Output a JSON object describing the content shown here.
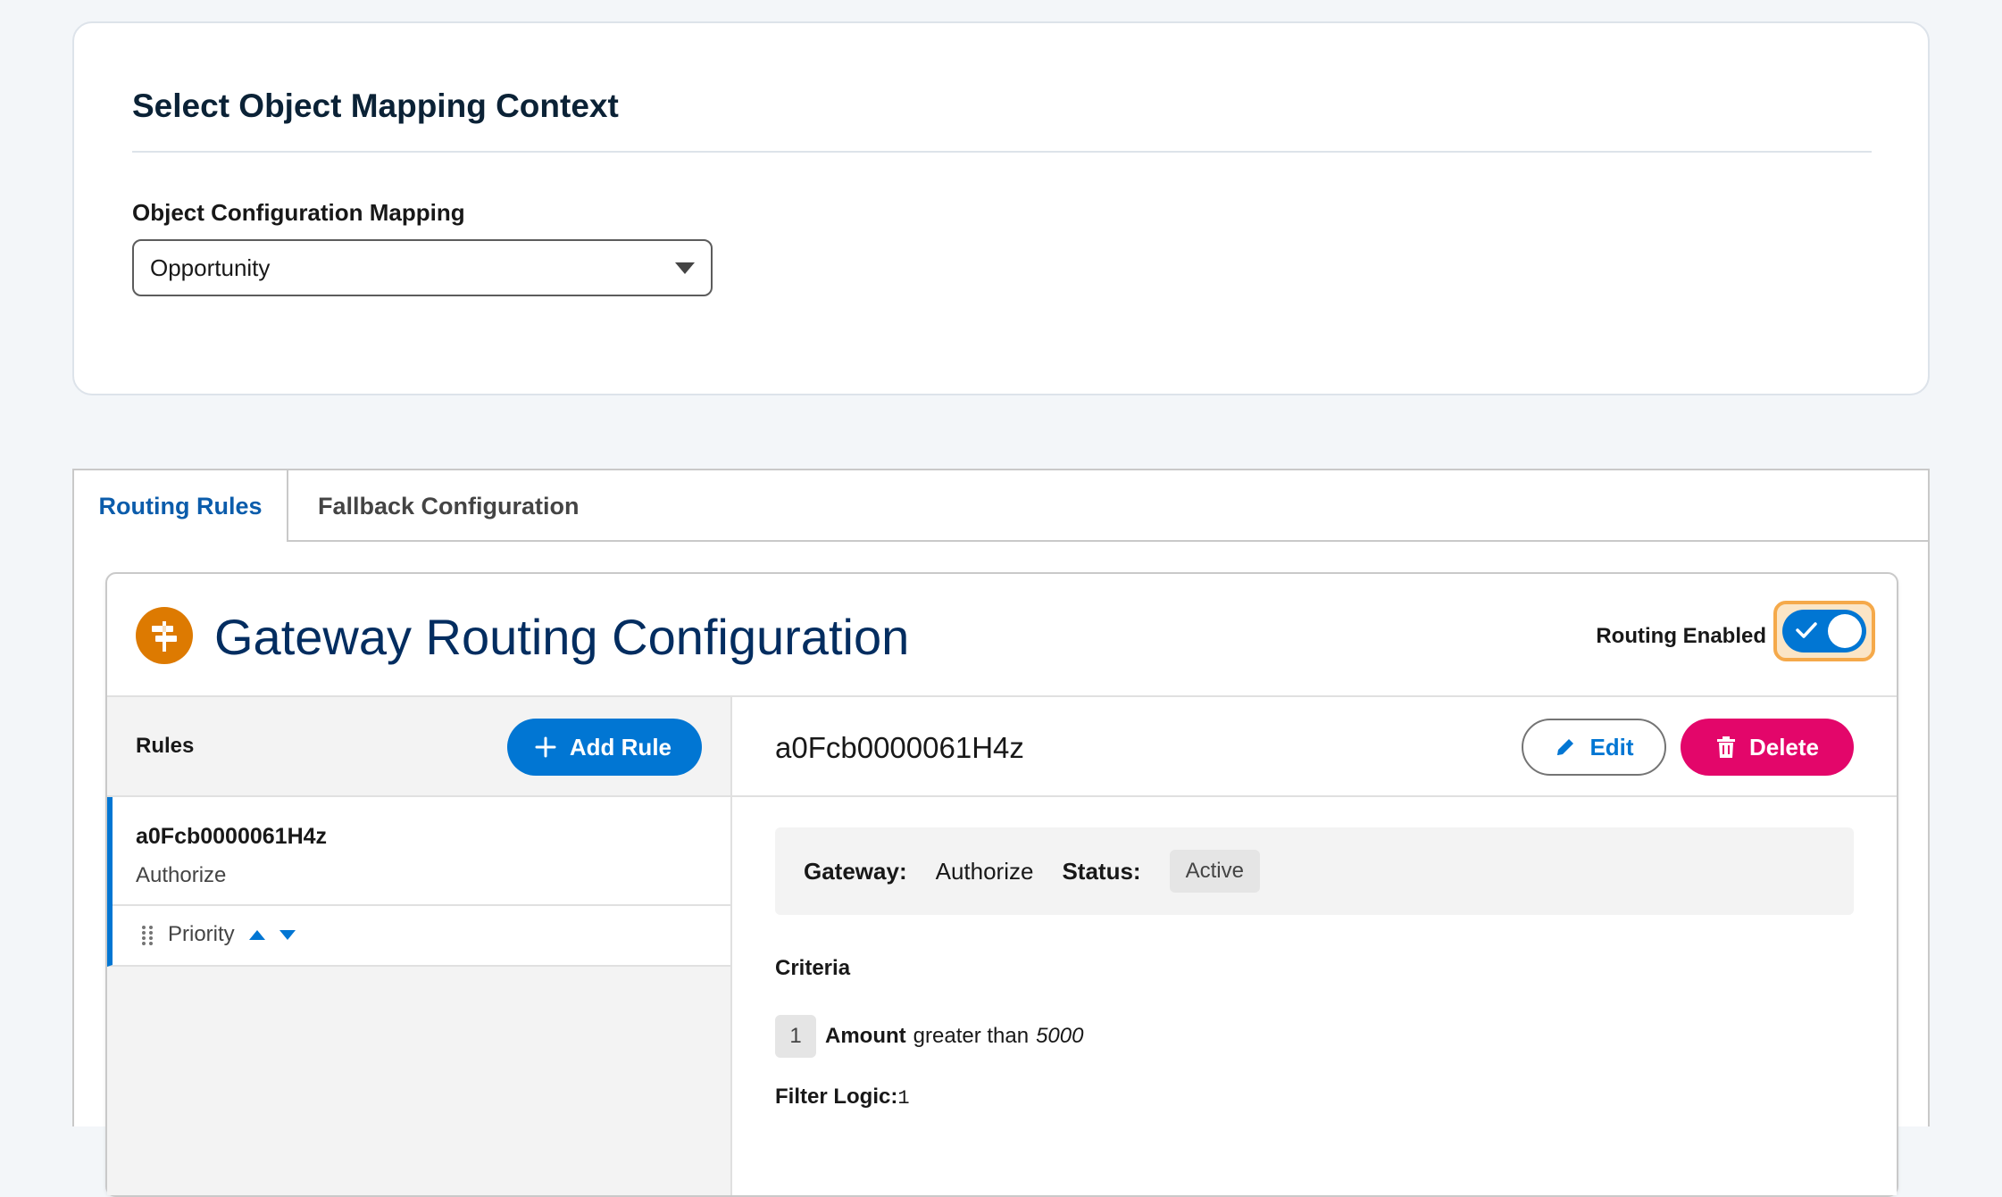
{
  "context_card": {
    "title": "Select Object Mapping Context",
    "field_label": "Object Configuration Mapping",
    "selected_value": "Opportunity"
  },
  "tabs": [
    {
      "label": "Routing Rules",
      "active": true
    },
    {
      "label": "Fallback Configuration",
      "active": false
    }
  ],
  "config": {
    "title": "Gateway Routing Configuration",
    "icon": "signpost-icon",
    "toggle_label": "Routing Enabled",
    "routing_enabled": true
  },
  "rules_panel": {
    "header": "Rules",
    "add_button": "Add Rule",
    "items": [
      {
        "name": "a0Fcb0000061H4z",
        "gateway": "Authorize",
        "priority_label": "Priority"
      }
    ]
  },
  "detail": {
    "title": "a0Fcb0000061H4z",
    "edit_label": "Edit",
    "delete_label": "Delete",
    "gateway_key": "Gateway:",
    "gateway_value": "Authorize",
    "status_key": "Status:",
    "status_value": "Active",
    "criteria_label": "Criteria",
    "criteria": [
      {
        "index": "1",
        "field": "Amount",
        "operator": "greater than",
        "value": "5000"
      }
    ],
    "filter_logic_key": "Filter Logic:",
    "filter_logic_value": "1"
  },
  "colors": {
    "brand": "#0176d3",
    "destructive": "#e3066a",
    "icon_orange": "#dd7a01",
    "title_navy": "#032d60"
  }
}
